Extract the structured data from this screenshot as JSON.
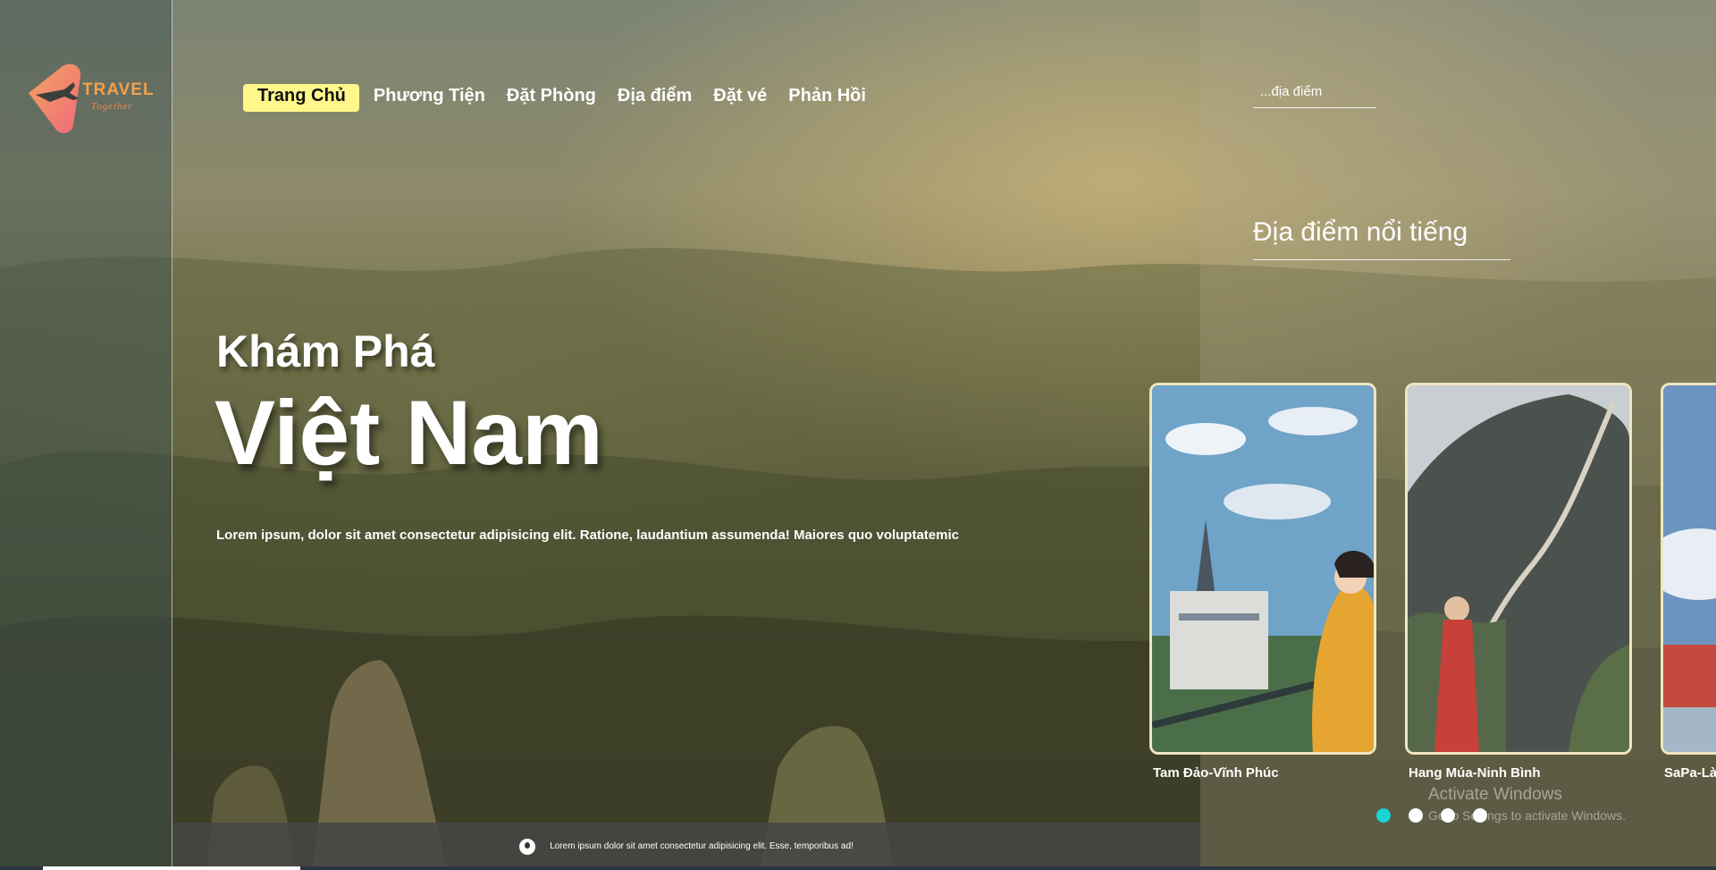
{
  "logo": {
    "title": "TRAVEL",
    "subtitle": "Together"
  },
  "nav": [
    {
      "label": "Trang Chủ",
      "active": true
    },
    {
      "label": "Phương Tiện"
    },
    {
      "label": "Đặt Phòng"
    },
    {
      "label": "Địa điểm"
    },
    {
      "label": "Đặt vé"
    },
    {
      "label": "Phản Hồi"
    }
  ],
  "search": {
    "placeholder": "...địa điểm"
  },
  "hero": {
    "subtitle": "Khám Phá",
    "title": "Việt Nam",
    "description": "Lorem ipsum, dolor sit amet consectetur adipisicing elit. Ratione, laudantium assumenda! Maiores quo voluptatemic"
  },
  "famous": {
    "title": "Địa điểm nổi tiếng",
    "cards": [
      {
        "label": "Tam Đảo-Vĩnh Phúc"
      },
      {
        "label": "Hang Múa-Ninh Bình"
      },
      {
        "label": "SaPa-Lào Cai"
      }
    ]
  },
  "carousel": {
    "dot_count": 4,
    "active_index": 0
  },
  "watermark": {
    "line1": "Activate Windows",
    "line2": "Go to Settings to activate Windows."
  },
  "footer": {
    "text": "Lorem ipsum dolor sit amet consectetur adipisicing elit. Esse, temporibus ad!"
  },
  "colors": {
    "nav_active_bg": "#fff78a",
    "dot_active": "#1ad4d4",
    "card_border": "#efe6c0"
  }
}
